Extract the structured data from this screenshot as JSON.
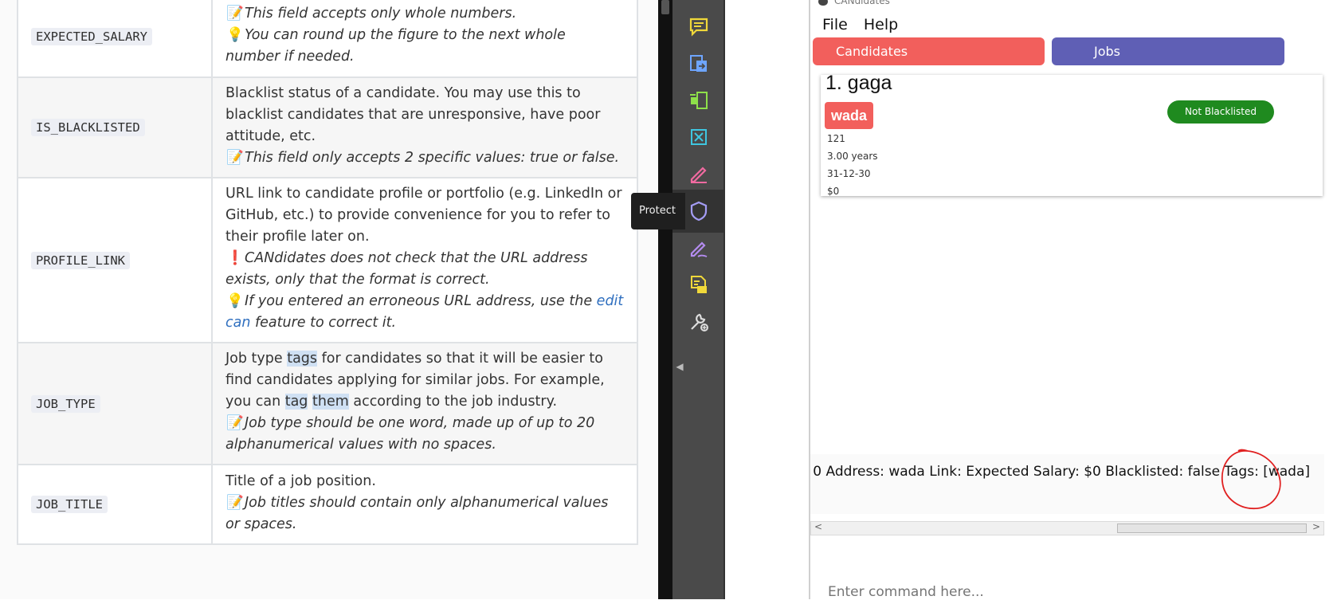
{
  "doc": {
    "rows": [
      {
        "key": "EXPECTED_SALARY",
        "note1": "This field accepts only whole numbers.",
        "tip": "You can round up the figure to the next whole number if needed."
      },
      {
        "key": "IS_BLACKLISTED",
        "desc": "Blacklist status of a candidate. You may use this to blacklist candidates that are unresponsive, have poor attitude, etc.",
        "note": "This field only accepts 2 specific values: true or false."
      },
      {
        "key": "PROFILE_LINK",
        "desc": "URL link to candidate profile or portfolio (e.g. LinkedIn or GitHub, etc.) to provide convenience for you to refer to their profile later on.",
        "warn": "CANdidates does not check that the URL address exists, only that the format is correct.",
        "tip_pre": "If you entered an erroneous URL address, use the ",
        "tip_link": "edit can",
        "tip_post": " feature to correct it."
      },
      {
        "key": "JOB_TYPE",
        "desc_a": "Job type ",
        "desc_h1": "tags",
        "desc_b": " for candidates so that it will be easier to find candidates applying for similar jobs. For example, you can ",
        "desc_h2": "tag",
        "desc_h3": "them",
        "desc_c": " according to the job industry.",
        "note": "Job type should be one word, made up of up to 20 alphanumerical values with no spaces."
      },
      {
        "key": "JOB_TITLE",
        "desc": "Title of a job position.",
        "note": "Job titles should contain only alphanumerical values or spaces."
      }
    ]
  },
  "toolbar": {
    "tooltip": "Protect",
    "icons": [
      "comment-icon",
      "export-pdf-icon",
      "organize-pages-icon",
      "edit-pdf-icon",
      "fill-sign-icon",
      "protect-icon",
      "request-signature-icon",
      "send-for-comments-icon",
      "more-tools-icon"
    ]
  },
  "app": {
    "title": "CANdidates",
    "menu": {
      "file": "File",
      "help": "Help"
    },
    "tabs": {
      "candidates": "Candidates",
      "jobs": "Jobs"
    },
    "card": {
      "name": "1.  gaga",
      "tag": "wada",
      "status": "Not Blacklisted",
      "fields": [
        "121",
        "3.00 years",
        "31-12-30",
        "$0"
      ]
    },
    "detail_text": "0 Address: wada Link:  Expected Salary: $0 Blacklisted: false Tags: [wada]",
    "command_placeholder": "Enter command here...",
    "colors": {
      "candidates_tab": "#f25f5c",
      "jobs_tab": "#5f5fb5",
      "badge": "#1f8a1f"
    }
  }
}
